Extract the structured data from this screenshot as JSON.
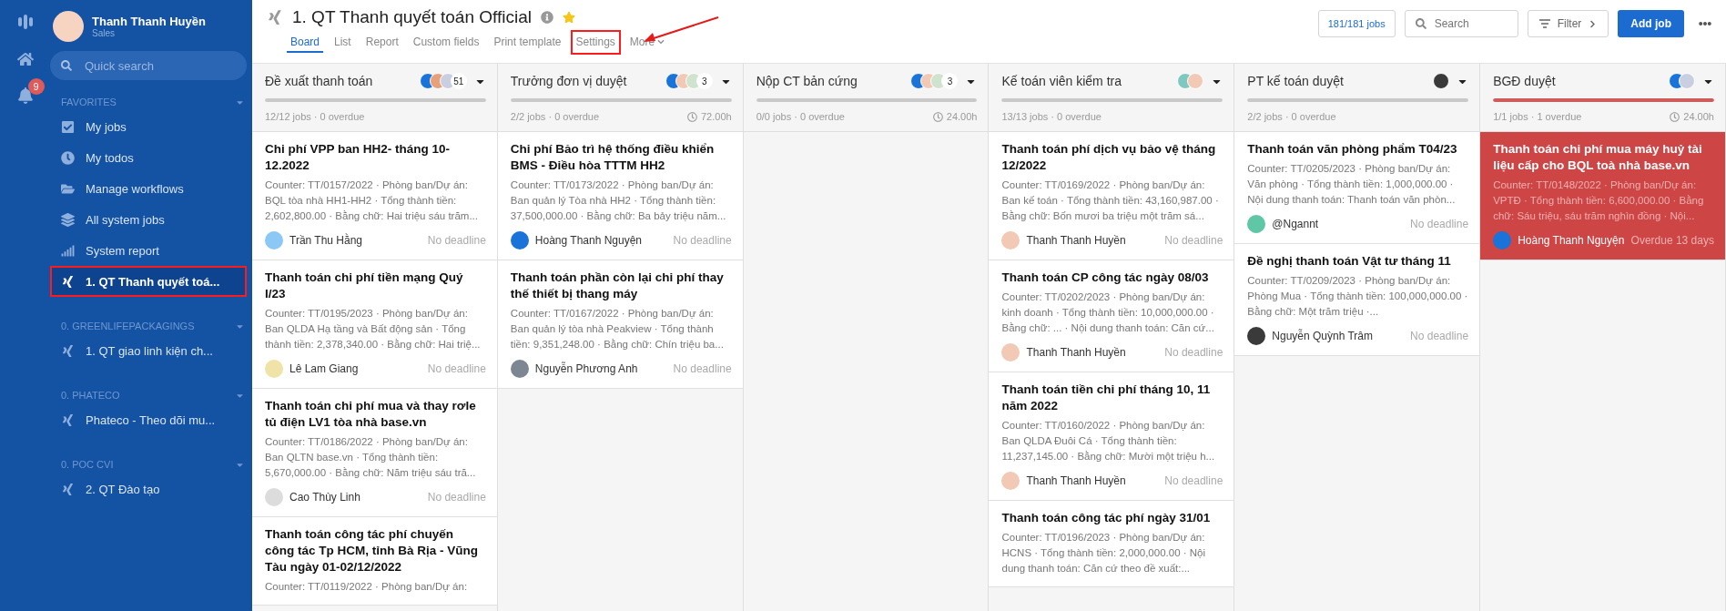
{
  "rail": {
    "notifications": "9"
  },
  "user": {
    "name": "Thanh Thanh Huyền",
    "role": "Sales"
  },
  "quick_search": {
    "placeholder": "Quick search"
  },
  "sidebar": {
    "groups": [
      {
        "label": "FAVORITES",
        "items": [
          {
            "label": "My jobs",
            "kind": "check",
            "selected": false,
            "annotated": false
          },
          {
            "label": "My todos",
            "kind": "clock",
            "selected": false,
            "annotated": false
          },
          {
            "label": "Manage workflows",
            "kind": "folder",
            "selected": false,
            "annotated": false
          },
          {
            "label": "All system jobs",
            "kind": "layers",
            "selected": false,
            "annotated": false
          },
          {
            "label": "System report",
            "kind": "chart",
            "selected": false,
            "annotated": false
          },
          {
            "label": "1. QT Thanh quyết toá...",
            "kind": "workflow",
            "selected": true,
            "annotated": true
          }
        ]
      },
      {
        "label": "0. GREENLIFEPACKAGINGS",
        "items": [
          {
            "label": "1. QT giao linh kiện ch...",
            "kind": "workflow",
            "selected": false,
            "annotated": false
          }
        ]
      },
      {
        "label": "0. PHATECO",
        "items": [
          {
            "label": "Phateco - Theo dõi mu...",
            "kind": "workflow",
            "selected": false,
            "annotated": false
          }
        ]
      },
      {
        "label": "0. POC CVI",
        "items": [
          {
            "label": "2. QT Đào tạo",
            "kind": "workflow",
            "selected": false,
            "annotated": false
          }
        ]
      }
    ]
  },
  "header": {
    "title": "1. QT Thanh quyết toán Official",
    "starred": true,
    "tabs": [
      {
        "label": "Board",
        "selected": true,
        "annotated": false
      },
      {
        "label": "List",
        "selected": false,
        "annotated": false
      },
      {
        "label": "Report",
        "selected": false,
        "annotated": false
      },
      {
        "label": "Custom fields",
        "selected": false,
        "annotated": false
      },
      {
        "label": "Print template",
        "selected": false,
        "annotated": false
      },
      {
        "label": "Settings",
        "selected": false,
        "annotated": true
      },
      {
        "label": "More",
        "selected": false,
        "annotated": false,
        "kind": "menu"
      }
    ],
    "jobs_count": "181/181 jobs",
    "search": {
      "placeholder": "Search"
    },
    "filter": "Filter",
    "add": "Add job"
  },
  "columns": [
    {
      "title": "Đề xuất thanh toán",
      "avatars": [
        {
          "color": "#1a73d9"
        },
        {
          "color": "#e8a07a"
        },
        {
          "color": "#c9cfe0"
        }
      ],
      "avatar_count": "51",
      "level": 1,
      "overdue": false,
      "stats": "12/12 jobs · 0 overdue",
      "cards": [
        {
          "title": "Chi phí VPP ban HH2- tháng 10-12.2022",
          "meta": "Counter: TT/0157/2022 · Phòng ban/Dự án: BQL tòa nhà HH1-HH2 · Tổng thành tiền: 2,602,800.00 · Bằng chữ: Hai triệu sáu trăm...",
          "assignee": "Trần Thu Hằng",
          "color": "#8cc8f5",
          "deadline": "No deadline",
          "overdue": false
        },
        {
          "title": "Thanh toán chi phí tiền mạng Quý I/23",
          "meta": "Counter: TT/0195/2023 · Phòng ban/Dự án: Ban QLDA Hạ tầng và Bất động sản · Tổng thành tiền: 2,378,340.00 · Bằng chữ: Hai triệ...",
          "assignee": "Lê Lam Giang",
          "color": "#efe3a8",
          "deadline": "No deadline",
          "overdue": false
        },
        {
          "title": "Thanh toán chi phí mua và thay rơle tủ điện LV1 tòa nhà base.vn",
          "meta": "Counter: TT/0186/2022 · Phòng ban/Dự án: Ban QLTN base.vn · Tổng thành tiền: 5,670,000.00 · Bằng chữ: Năm triệu sáu tră...",
          "assignee": "Cao Thùy Linh",
          "color": "#dcdcdc",
          "deadline": "No deadline",
          "overdue": false
        },
        {
          "title": "Thanh toán công tác phí chuyến công tác Tp HCM, tỉnh Bà Rịa - Vũng Tàu ngày 01-02/12/2022",
          "meta": "Counter: TT/0119/2022 · Phòng ban/Dự án:",
          "overdue": false
        }
      ]
    },
    {
      "title": "Trưởng đơn vị duyệt",
      "avatars": [
        {
          "color": "#1a73d9"
        },
        {
          "color": "#f2c9b5"
        },
        {
          "color": "#cfe3cf"
        }
      ],
      "avatar_count": "3",
      "level": 1,
      "overdue": false,
      "stats": "2/2 jobs · 0 overdue",
      "time": "72.00h",
      "cards": [
        {
          "title": "Chi phí Bảo trì hệ thống điều khiển BMS - Điều hòa TTTM HH2",
          "meta": "Counter: TT/0173/2022 · Phòng ban/Dự án: Ban quản lý Tòa nhà HH2 · Tổng thành tiền: 37,500,000.00 · Bằng chữ: Ba bảy triệu năm...",
          "assignee": "Hoàng Thanh Nguyện",
          "color": "#1a73d9",
          "deadline": "No deadline",
          "overdue": false
        },
        {
          "title": "Thanh toán phần còn lại chi phí thay thế thiết bị thang máy",
          "meta": "Counter: TT/0167/2022 · Phòng ban/Dự án: Ban quản lý tòa nhà Peakview · Tổng thành tiền: 9,351,248.00 · Bằng chữ: Chín triệu ba...",
          "assignee": "Nguyễn Phương Anh",
          "color": "#7d8794",
          "deadline": "No deadline",
          "overdue": false
        }
      ]
    },
    {
      "title": "Nộp CT bản cứng",
      "avatars": [
        {
          "color": "#1a73d9"
        },
        {
          "color": "#f2c9b5"
        },
        {
          "color": "#cfe3cf"
        }
      ],
      "avatar_count": "3",
      "level": 1,
      "overdue": false,
      "stats": "0/0 jobs · 0 overdue",
      "time": "24.00h"
    },
    {
      "title": "Kế toán viên kiểm tra",
      "avatars": [
        {
          "color": "#7fc8c0"
        },
        {
          "color": "#f2c9b5"
        }
      ],
      "level": 1,
      "overdue": false,
      "stats": "13/13 jobs · 0 overdue",
      "cards": [
        {
          "title": "Thanh toán phí dịch vụ bảo vệ tháng 12/2022",
          "meta": "Counter: TT/0169/2022 · Phòng ban/Dự án: Ban kế toán · Tổng thành tiền: 43,160,987.00 · Bằng chữ: Bốn mươi ba triệu một trăm sá...",
          "assignee": "Thanh Thanh Huyền",
          "color": "#f2c9b5",
          "deadline": "No deadline",
          "overdue": false
        },
        {
          "title": "Thanh toán CP công tác ngày 08/03",
          "meta": "Counter: TT/0202/2023 · Phòng ban/Dự án: kinh doanh · Tổng thành tiền: 10,000,000.00 · Bằng chữ: ... · Nội dung thanh toán: Căn cứ...",
          "assignee": "Thanh Thanh Huyền",
          "color": "#f2c9b5",
          "deadline": "No deadline",
          "overdue": false
        },
        {
          "title": "Thanh toán tiền chi phí tháng 10, 11 năm 2022",
          "meta": "Counter: TT/0160/2022 · Phòng ban/Dự án: Ban QLDA Đuôi Cá · Tổng thành tiền: 11,237,145.00 · Bằng chữ: Mười một triệu h...",
          "assignee": "Thanh Thanh Huyền",
          "color": "#f2c9b5",
          "deadline": "No deadline",
          "overdue": false
        },
        {
          "title": "Thanh toán công tác phí ngày 31/01",
          "meta": "Counter: TT/0196/2023 · Phòng ban/Dự án: HCNS · Tổng thành tiền: 2,000,000.00 · Nội dung thanh toán: Căn cứ theo đề xuất:...",
          "overdue": false
        }
      ]
    },
    {
      "title": "PT kế toán duyệt",
      "avatars": [
        {
          "color": "#3a3a3a"
        }
      ],
      "level": 1,
      "overdue": false,
      "stats": "2/2 jobs · 0 overdue",
      "cards": [
        {
          "title": "Thanh toán văn phòng phẩm T04/23",
          "meta": "Counter: TT/0205/2023 · Phòng ban/Dự án: Văn phòng · Tổng thành tiền: 1,000,000.00 · Nội dung thanh toán: Thanh toán văn phòn...",
          "assignee": "@Ngannt",
          "color": "#5fc7a6",
          "deadline": "No deadline",
          "overdue": false
        },
        {
          "title": "Đề nghị thanh toán Vật tư tháng 11",
          "meta": "Counter: TT/0209/2023 · Phòng ban/Dự án: Phòng Mua · Tổng thành tiền: 100,000,000.00 · Bằng chữ: Một trăm triệu ·...",
          "assignee": "Nguyễn Quỳnh Trâm",
          "color": "#3a3a3a",
          "deadline": "No deadline",
          "overdue": false
        }
      ]
    },
    {
      "title": "BGĐ duyệt",
      "avatars": [
        {
          "color": "#1a73d9"
        },
        {
          "color": "#c9cfe0"
        }
      ],
      "level": 1,
      "overdue": true,
      "stats": "1/1 jobs · 1 overdue",
      "time": "24.00h",
      "cards": [
        {
          "title": "Thanh toán chi phí mua máy huỷ tài liệu cấp cho BQL toà nhà base.vn",
          "meta": "Counter: TT/0148/2022 · Phòng ban/Dự án: VPTĐ · Tổng thành tiền: 6,600,000.00 · Bằng chữ: Sáu triệu, sáu trăm nghìn đồng · Nội...",
          "assignee": "Hoàng Thanh Nguyện",
          "color": "#1a73d9",
          "deadline": "Overdue 13 days",
          "overdue": true
        }
      ]
    }
  ]
}
